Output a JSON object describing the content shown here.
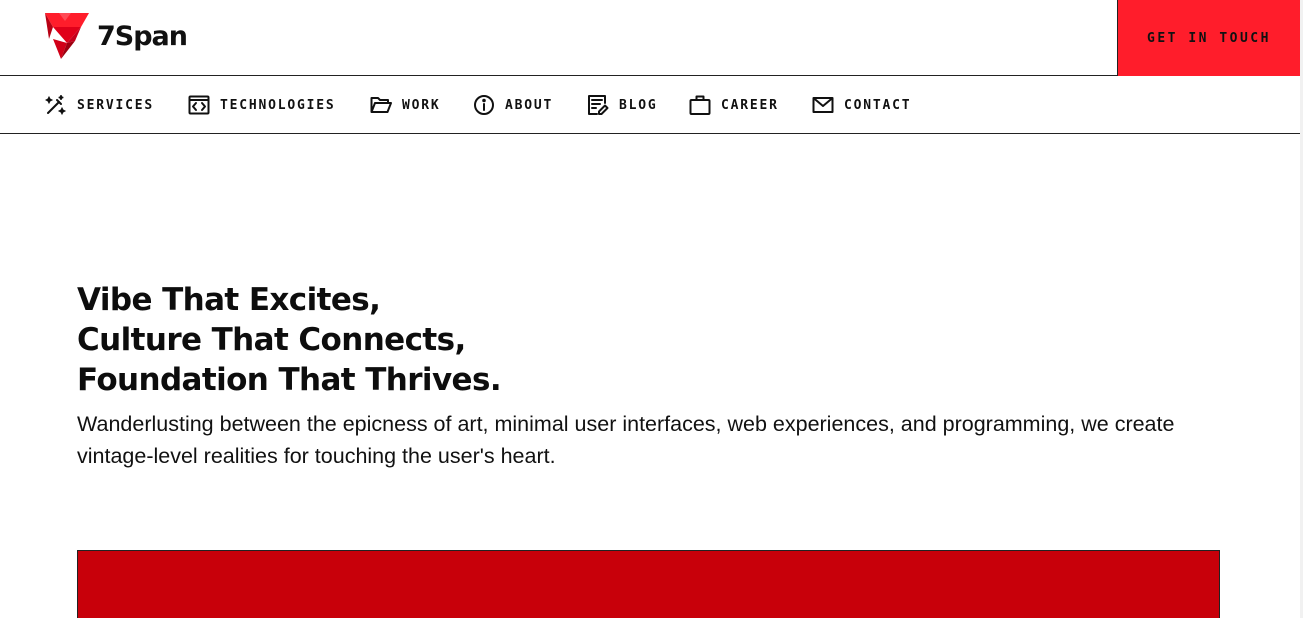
{
  "header": {
    "logo_text": "7Span",
    "cta_label": "GET IN TOUCH"
  },
  "nav": {
    "items": [
      {
        "label": "SERVICES",
        "icon": "magic-wand-icon"
      },
      {
        "label": "TECHNOLOGIES",
        "icon": "code-window-icon"
      },
      {
        "label": "WORK",
        "icon": "folder-open-icon"
      },
      {
        "label": "ABOUT",
        "icon": "info-circle-icon"
      },
      {
        "label": "BLOG",
        "icon": "document-pen-icon"
      },
      {
        "label": "CAREER",
        "icon": "briefcase-icon"
      },
      {
        "label": "CONTACT",
        "icon": "envelope-icon"
      }
    ]
  },
  "hero": {
    "lines": [
      "Vibe That Excites,",
      "Culture That Connects,",
      "Foundation That Thrives."
    ],
    "description": "Wanderlusting between the epicness of art, minimal user interfaces, web experiences, and programming, we create vintage-level realities for touching the user's heart."
  },
  "colors": {
    "accent": "#ff1d2b",
    "block": "#c8000a",
    "text": "#111111"
  }
}
